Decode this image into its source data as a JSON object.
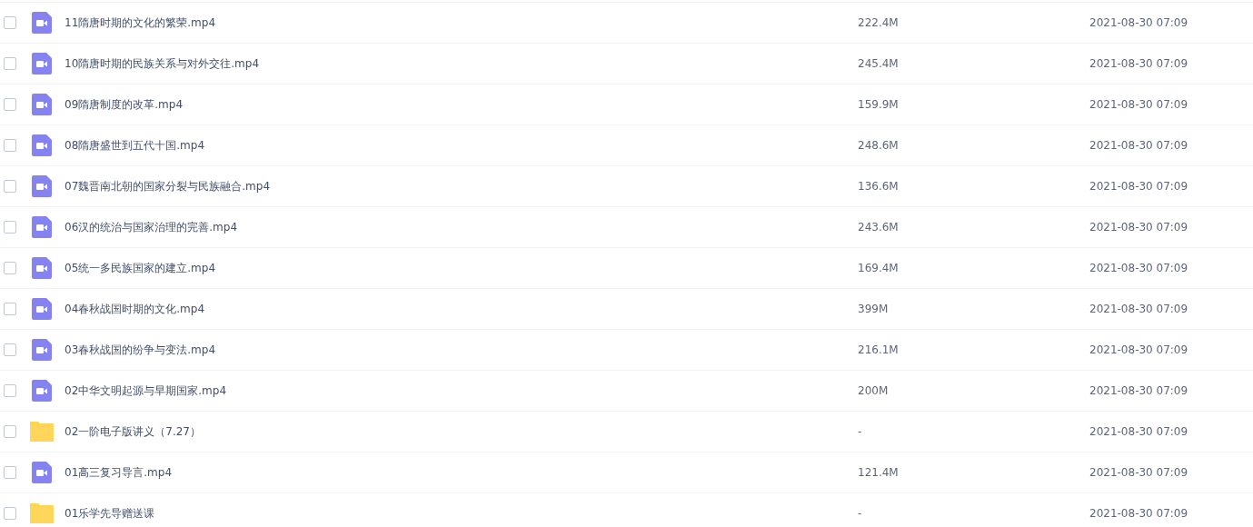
{
  "files": [
    {
      "kind": "video",
      "name": "11隋唐时期的文化的繁荣.mp4",
      "size": "222.4M",
      "modified": "2021-08-30 07:09",
      "checked": false
    },
    {
      "kind": "video",
      "name": "10隋唐时期的民族关系与对外交往.mp4",
      "size": "245.4M",
      "modified": "2021-08-30 07:09",
      "checked": false
    },
    {
      "kind": "video",
      "name": "09隋唐制度的改革.mp4",
      "size": "159.9M",
      "modified": "2021-08-30 07:09",
      "checked": false
    },
    {
      "kind": "video",
      "name": "08隋唐盛世到五代十国.mp4",
      "size": "248.6M",
      "modified": "2021-08-30 07:09",
      "checked": false
    },
    {
      "kind": "video",
      "name": "07魏晋南北朝的国家分裂与民族融合.mp4",
      "size": "136.6M",
      "modified": "2021-08-30 07:09",
      "checked": false
    },
    {
      "kind": "video",
      "name": "06汉的统治与国家治理的完善.mp4",
      "size": "243.6M",
      "modified": "2021-08-30 07:09",
      "checked": false
    },
    {
      "kind": "video",
      "name": "05统一多民族国家的建立.mp4",
      "size": "169.4M",
      "modified": "2021-08-30 07:09",
      "checked": false
    },
    {
      "kind": "video",
      "name": "04春秋战国时期的文化.mp4",
      "size": "399M",
      "modified": "2021-08-30 07:09",
      "checked": false
    },
    {
      "kind": "video",
      "name": "03春秋战国的纷争与变法.mp4",
      "size": "216.1M",
      "modified": "2021-08-30 07:09",
      "checked": false
    },
    {
      "kind": "video",
      "name": "02中华文明起源与早期国家.mp4",
      "size": "200M",
      "modified": "2021-08-30 07:09",
      "checked": false
    },
    {
      "kind": "folder",
      "name": "02一阶电子版讲义（7.27）",
      "size": "-",
      "modified": "2021-08-30 07:09",
      "checked": false
    },
    {
      "kind": "video",
      "name": "01高三复习导言.mp4",
      "size": "121.4M",
      "modified": "2021-08-30 07:09",
      "checked": false
    },
    {
      "kind": "folder",
      "name": "01乐学先导赠送课",
      "size": "-",
      "modified": "2021-08-30 07:09",
      "checked": false
    }
  ]
}
